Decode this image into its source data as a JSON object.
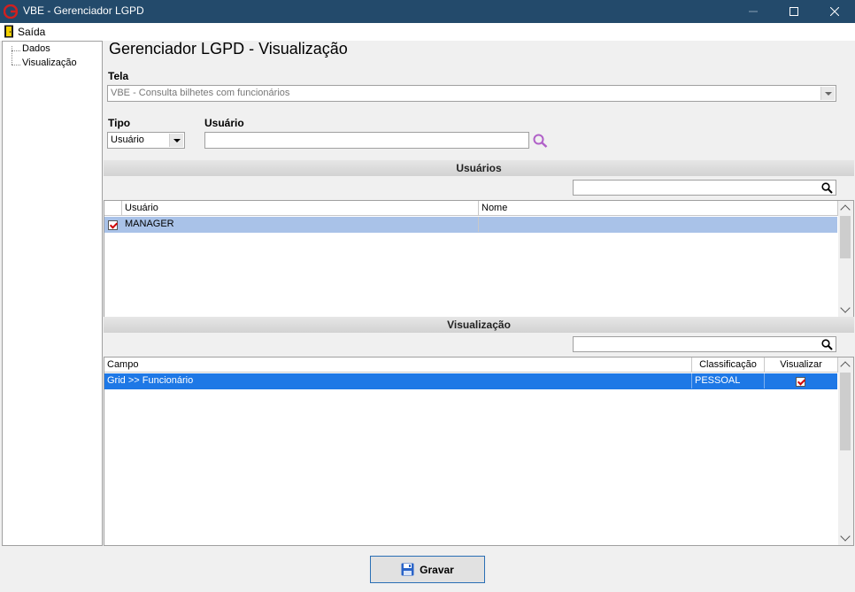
{
  "window": {
    "title": "VBE - Gerenciador LGPD"
  },
  "menu": {
    "exit_label": "Saída"
  },
  "tree": {
    "items": [
      "Dados",
      "Visualização"
    ]
  },
  "heading": "Gerenciador LGPD - Visualização",
  "tela": {
    "label": "Tela",
    "value": "VBE - Consulta bilhetes com funcionários"
  },
  "tipo": {
    "label": "Tipo",
    "value": "Usuário"
  },
  "usuario_field": {
    "label": "Usuário",
    "value": ""
  },
  "users_section": {
    "title": "Usuários",
    "search_value": "",
    "columns": [
      "Usuário",
      "Nome"
    ],
    "rows": [
      {
        "checked": true,
        "usuario": "MANAGER",
        "nome": ""
      }
    ]
  },
  "view_section": {
    "title": "Visualização",
    "search_value": "",
    "columns": [
      "Campo",
      "Classificação",
      "Visualizar"
    ],
    "rows": [
      {
        "campo": "Grid >> Funcionário",
        "classificacao": "PESSOAL",
        "visualizar": true
      }
    ]
  },
  "buttons": {
    "save_label": "Gravar"
  },
  "colors": {
    "titlebar": "#234a6b",
    "row_selected_users": "#a9c2e8",
    "row_selected_view": "#1e78e6"
  }
}
